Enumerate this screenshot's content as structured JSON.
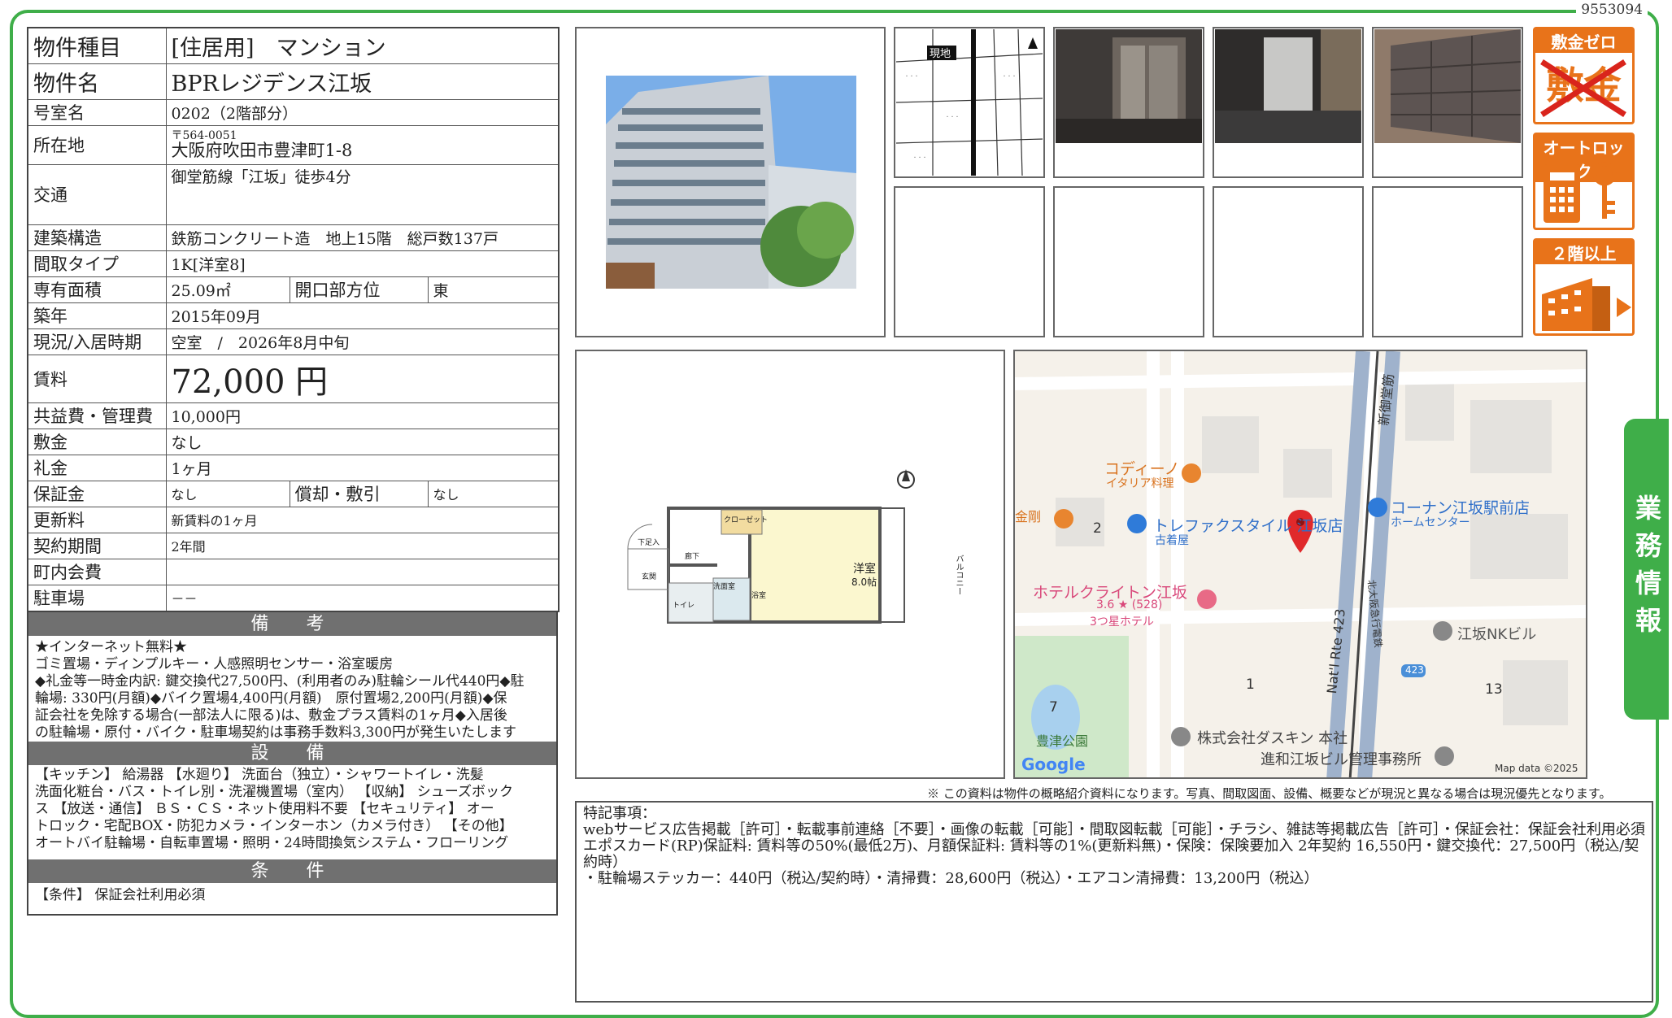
{
  "doc_id": "9553094",
  "rows": {
    "type": {
      "label": "物件種目",
      "value": "[住居用]　マンション"
    },
    "name": {
      "label": "物件名",
      "value": "BPRレジデンス江坂"
    },
    "room": {
      "label": "号室名",
      "value": "0202（2階部分）"
    },
    "location": {
      "label": "所在地",
      "zip": "〒564-0051",
      "value": "大阪府吹田市豊津町1-8"
    },
    "transport": {
      "label": "交通",
      "value": "御堂筋線「江坂」徒歩4分"
    },
    "structure": {
      "label": "建築構造",
      "value": "鉄筋コンクリート造　地上15階　総戸数137戸"
    },
    "layout": {
      "label": "間取タイプ",
      "value": "1K[洋室8]"
    },
    "area": {
      "label": "専有面積",
      "value": "25.09㎡",
      "label2": "開口部方位",
      "value2": "東"
    },
    "built": {
      "label": "築年",
      "value": "2015年09月"
    },
    "status": {
      "label": "現況/入居時期",
      "value": "空室　/　2026年8月中旬"
    },
    "rent": {
      "label": "賃料",
      "value": "72,000 円"
    },
    "fee": {
      "label": "共益費・管理費",
      "value": "10,000円"
    },
    "deposit": {
      "label": "敷金",
      "value": "なし"
    },
    "key_money": {
      "label": "礼金",
      "value": "1ヶ月"
    },
    "guarantee": {
      "label": "保証金",
      "value": "なし",
      "label2": "償却・敷引",
      "value2": "なし"
    },
    "renewal": {
      "label": "更新料",
      "value": "新賃料の1ヶ月"
    },
    "contract": {
      "label": "契約期間",
      "value": "2年間"
    },
    "community": {
      "label": "町内会費",
      "value": ""
    },
    "parking": {
      "label": "駐車場",
      "value": "－－"
    }
  },
  "remarks": {
    "title": "備　考",
    "lines": [
      "★インターネット無料★",
      "ゴミ置場・ディンプルキー・人感照明センサー・浴室暖房",
      "◆礼金等一時金内訳: 鍵交換代27,500円、(利用者のみ)駐輪シール代440円◆駐",
      "輪場: 330円(月額)◆バイク置場4,400円(月額)　原付置場2,200円(月額)◆保",
      "証会社を免除する場合(一部法人に限る)は、敷金プラス賃料の1ヶ月◆入居後",
      "の駐輪場・原付・バイク・駐車場契約は事務手数料3,300円が発生いたします"
    ]
  },
  "facilities": {
    "title": "設　備",
    "lines": [
      "【キッチン】 給湯器 【水廻り】 洗面台（独立）・シャワートイレ・洗髪",
      "洗面化粧台・バス・トイレ別・洗濯機置場（室内） 【収納】 シューズボック",
      "ス 【放送・通信】 ＢＳ・ＣＳ・ネット使用料不要 【セキュリティ】 オー",
      "トロック・宅配BOX・防犯カメラ・インターホン（カメラ付き） 【その他】",
      "オートバイ駐輪場・自転車置場・照明・24時間換気システム・フローリング"
    ]
  },
  "conditions": {
    "title": "条　件",
    "text": "【条件】 保証会社利用必須"
  },
  "badges": [
    {
      "title": "敷金ゼロ",
      "body": "敷金"
    },
    {
      "title": "オートロック",
      "body": ""
    },
    {
      "title": "２階以上",
      "body": ""
    }
  ],
  "side_tab": "業務情報",
  "floorplan": {
    "room_label": "洋室",
    "room_size": "8.0帖",
    "closet": "クローゼット",
    "balcony": "バルコニー",
    "hall": "廊下",
    "entrance": "玄関",
    "shoes": "下足入",
    "wash": "洗面室",
    "bath": "浴室",
    "toilet": "トイレ"
  },
  "small_map": {
    "current": "現地"
  },
  "map": {
    "labels": [
      "コディーノ",
      "イタリア料理",
      "トレファクスタイル 江坂店",
      "古着屋",
      "コーナン江坂駅前店",
      "ホームセンター",
      "ホテルクライトン江坂",
      "3.6 ★ (528)",
      "3つ星ホテル",
      "江坂NKビル",
      "株式会社ダスキン 本社",
      "進和江坂ビル管理事務所",
      "豊津公園",
      "Nat'l Rte 423",
      "新御堂筋",
      "北大阪急行電鉄",
      "423",
      "2",
      "1",
      "7",
      "13",
      "Google",
      "Map data ©2025",
      "金剛"
    ]
  },
  "note": "※ この資料は物件の概略紹介資料になります。写真、間取図面、設備、概要などが現況と異なる場合は現況優先となります。",
  "special": {
    "title": "特記事項：",
    "lines": [
      "webサービス広告掲載［許可］・転載事前連絡［不要］・画像の転載［可能］・間取図転載［可能］・チラシ、雑誌等掲載広告［許可］・保証会社：保証会社利用必須",
      "エポスカード(RP)保証料: 賃料等の50%(最低2万)、月額保証料: 賃料等の1%(更新料無)・保険：保険要加入 2年契約 16,550円・鍵交換代：27,500円（税込/契約時）",
      "・駐輪場ステッカー：440円（税込/契約時）・清掃費：28,600円（税込）・エアコン清掃費：13,200円（税込）"
    ]
  }
}
